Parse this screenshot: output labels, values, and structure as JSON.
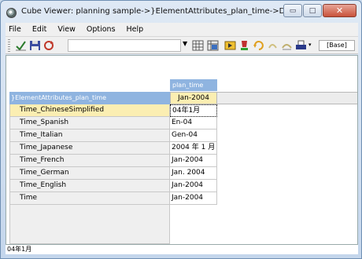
{
  "window": {
    "title": "Cube Viewer: planning sample->}ElementAttributes_plan_time->Default",
    "min_glyph": "▭",
    "max_glyph": "□",
    "close_glyph": "✕"
  },
  "menu": [
    {
      "label": "File"
    },
    {
      "label": "Edit"
    },
    {
      "label": "View"
    },
    {
      "label": "Options"
    },
    {
      "label": "Help"
    }
  ],
  "toolbar": {
    "base_label": "[Base]",
    "combo_value": "",
    "icons": [
      "check-icon",
      "save-icon",
      "recalc-icon",
      "grid-icon",
      "grid-options-icon",
      "arrow-right-icon",
      "paint-icon",
      "undo-icon",
      "redo-icon",
      "chart-icon",
      "print-icon"
    ]
  },
  "grid": {
    "column_dimension": "plan_time",
    "column_element": "Jan-2004",
    "row_dimension": "}ElementAttributes_plan_time",
    "rows": [
      {
        "label": "Time_ChineseSimplified",
        "value": "04年1月"
      },
      {
        "label": "Time_Spanish",
        "value": "En-04"
      },
      {
        "label": "Time_Italian",
        "value": "Gen-04"
      },
      {
        "label": "Time_Japanese",
        "value": "2004 年 1 月"
      },
      {
        "label": "Time_French",
        "value": "Jan-2004"
      },
      {
        "label": "Time_German",
        "value": "Jan. 2004"
      },
      {
        "label": "Time_English",
        "value": "Jan-2004"
      },
      {
        "label": "Time",
        "value": "Jan-2004"
      }
    ]
  },
  "status": {
    "text": "04年1月"
  },
  "colors": {
    "header_blue": "#8fb4e0",
    "selected_yellow": "#fbeeb2"
  }
}
